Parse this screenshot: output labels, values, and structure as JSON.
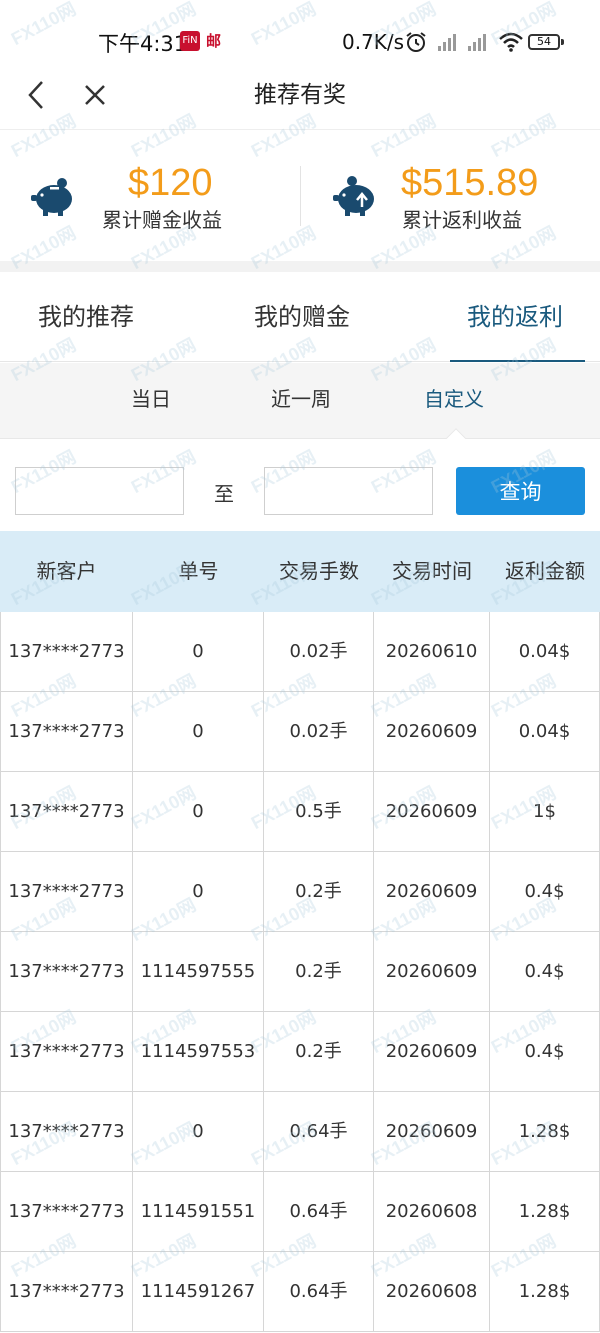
{
  "status_bar": {
    "time": "下午4:31",
    "badge_red": "FiN",
    "badge_mail": "邮",
    "net_speed": "0.7K/s",
    "battery": "54",
    "icons": [
      "alarm-icon",
      "signal-icon",
      "signal-icon",
      "wifi-icon",
      "battery-icon"
    ]
  },
  "nav": {
    "title": "推荐有奖",
    "back_icon": "chevron-left-icon",
    "close_icon": "close-icon"
  },
  "summary": {
    "gift": {
      "amount": "$120",
      "label": "累计赠金收益",
      "icon": "piggy-bank-icon"
    },
    "rebate": {
      "amount": "$515.89",
      "label": "累计返利收益",
      "icon": "piggy-bank-arrow-icon"
    },
    "amount_color": "#f39c1a",
    "icon_color": "#1a4a6e"
  },
  "tabs": [
    {
      "label": "我的推荐",
      "active": false
    },
    {
      "label": "我的赠金",
      "active": false
    },
    {
      "label": "我的返利",
      "active": true
    }
  ],
  "range": {
    "options": [
      "当日",
      "近一周",
      "自定义"
    ],
    "selected": "自定义"
  },
  "query": {
    "start_value": "",
    "end_value": "",
    "separator": "至",
    "button_label": "查询",
    "button_color": "#1b8fdc"
  },
  "table": {
    "headers": [
      "新客户",
      "单号",
      "交易手数",
      "交易时间",
      "返利金额"
    ],
    "rows": [
      [
        "137****2773",
        "0",
        "0.02手",
        "20260610",
        "0.04$"
      ],
      [
        "137****2773",
        "0",
        "0.02手",
        "20260609",
        "0.04$"
      ],
      [
        "137****2773",
        "0",
        "0.5手",
        "20260609",
        "1$"
      ],
      [
        "137****2773",
        "0",
        "0.2手",
        "20260609",
        "0.4$"
      ],
      [
        "137****2773",
        "1114597555",
        "0.2手",
        "20260609",
        "0.4$"
      ],
      [
        "137****2773",
        "1114597553",
        "0.2手",
        "20260609",
        "0.4$"
      ],
      [
        "137****2773",
        "0",
        "0.64手",
        "20260609",
        "1.28$"
      ],
      [
        "137****2773",
        "1114591551",
        "0.64手",
        "20260608",
        "1.28$"
      ],
      [
        "137****2773",
        "1114591267",
        "0.64手",
        "20260608",
        "1.28$"
      ]
    ],
    "header_bg": "#d9ecf7"
  },
  "accent_color": "#1a5a7e",
  "watermark": "FX110网"
}
